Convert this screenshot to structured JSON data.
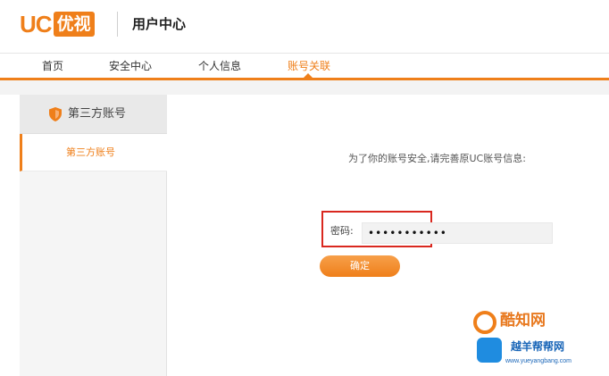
{
  "header": {
    "logo_text": "UC",
    "logo_box_text": "优视",
    "page_title": "用户中心"
  },
  "nav": {
    "items": [
      {
        "label": "首页",
        "active": false
      },
      {
        "label": "安全中心",
        "active": false
      },
      {
        "label": "个人信息",
        "active": false
      },
      {
        "label": "账号关联",
        "active": true
      }
    ]
  },
  "sidebar": {
    "heading": "第三方账号",
    "items": [
      {
        "label": "第三方账号",
        "active": true
      }
    ]
  },
  "main": {
    "instruction": "为了你的账号安全,请完善原UC账号信息:",
    "password_label": "密码:",
    "password_value": "•••••••••••",
    "confirm_label": "确定"
  },
  "watermark": {
    "brand": "酷知网",
    "brand2": "越羊帮帮网",
    "url": "www.yueyangbang.com"
  },
  "colors": {
    "accent": "#ef7f1a",
    "highlight": "#d9281f"
  }
}
